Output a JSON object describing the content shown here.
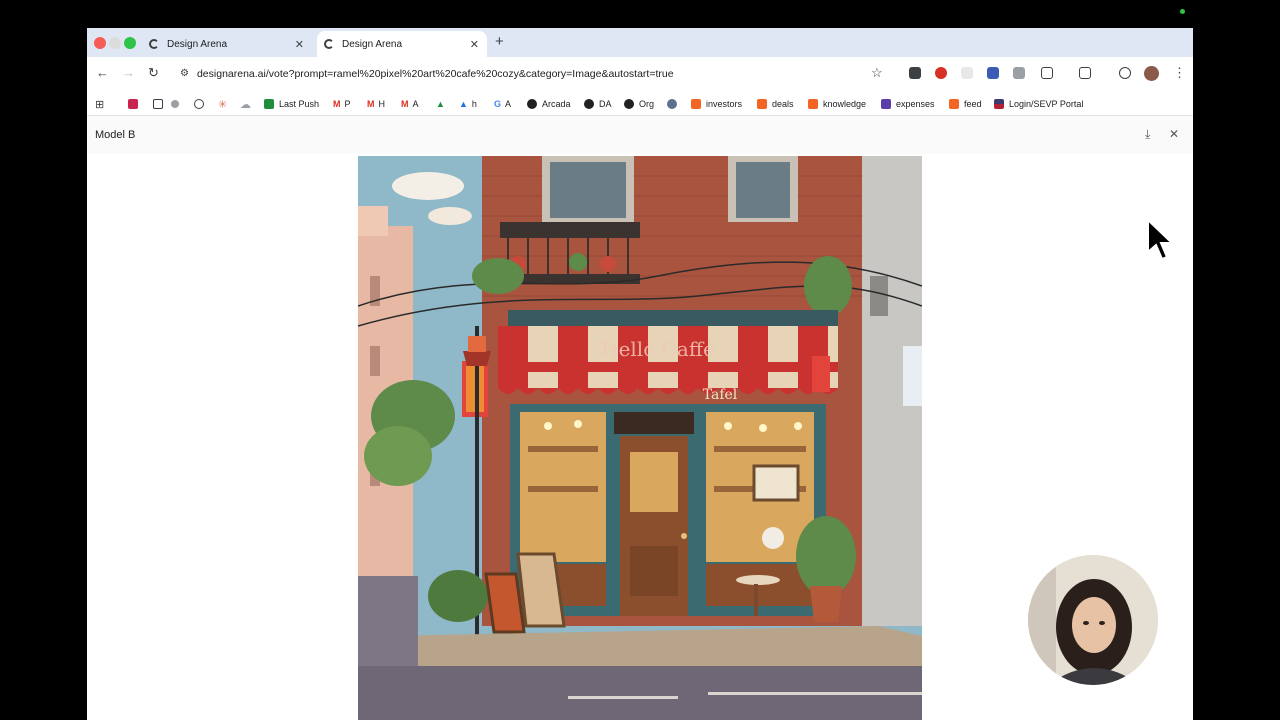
{
  "tabs": [
    {
      "title": "Design Arena",
      "active": false
    },
    {
      "title": "Design Arena",
      "active": true
    }
  ],
  "toolbar": {
    "url_host": "designarena.ai",
    "url_path": "/vote?prompt=ramel%20pixel%20art%20cafe%20cozy&category=Image&autostart=true"
  },
  "bookmarks": [
    {
      "label": "Last Push",
      "icon": "plus-square-icon",
      "color": "#1e8e3e"
    },
    {
      "label": "P",
      "icon": "gmail-icon",
      "color": "#d93025"
    },
    {
      "label": "H",
      "icon": "gmail-icon",
      "color": "#d93025"
    },
    {
      "label": "A",
      "icon": "gmail-icon",
      "color": "#d93025"
    },
    {
      "label": "h",
      "icon": "drive-icon",
      "color": "#1a73e8"
    },
    {
      "label": "A",
      "icon": "google-icon",
      "color": "#4285f4"
    },
    {
      "label": "Arcada",
      "icon": "github-icon",
      "color": "#202124"
    },
    {
      "label": "DA",
      "icon": "github-icon",
      "color": "#202124"
    },
    {
      "label": "Org",
      "icon": "github-icon",
      "color": "#202124"
    },
    {
      "label": "investors",
      "icon": "ycombinator-icon",
      "color": "#f26522"
    },
    {
      "label": "deals",
      "icon": "ycombinator-icon",
      "color": "#f26522"
    },
    {
      "label": "knowledge",
      "icon": "ycombinator-icon",
      "color": "#f26522"
    },
    {
      "label": "expenses",
      "icon": "list-icon",
      "color": "#5b3fa8"
    },
    {
      "label": "feed",
      "icon": "ycombinator-icon",
      "color": "#f26522"
    },
    {
      "label": "Login/SEVP Portal",
      "icon": "us-flag-icon",
      "color": "#3c3b6e"
    }
  ],
  "panel": {
    "title": "Model B"
  },
  "artwork": {
    "awning_text": "Hello Caffe",
    "sign_text": "Tafel"
  }
}
